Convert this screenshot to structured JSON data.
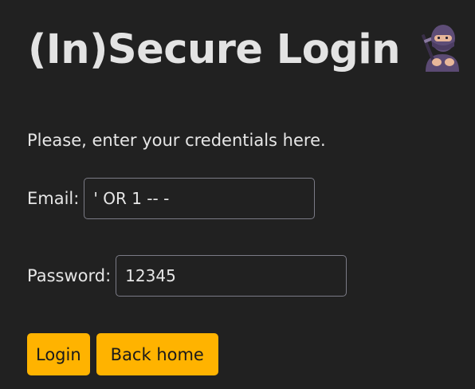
{
  "header": {
    "title": "(In)Secure Login",
    "icon": "ninja-icon"
  },
  "form": {
    "intro": "Please, enter your credentials here.",
    "email": {
      "label": "Email:",
      "value": "' OR 1 -- -"
    },
    "password": {
      "label": "Password:",
      "value": "12345"
    }
  },
  "buttons": {
    "login_label": "Login",
    "back_label": "Back home"
  },
  "colors": {
    "background": "#212121",
    "text": "#e6e6e6",
    "button": "#ffb300",
    "input_border": "#7b7b86"
  }
}
